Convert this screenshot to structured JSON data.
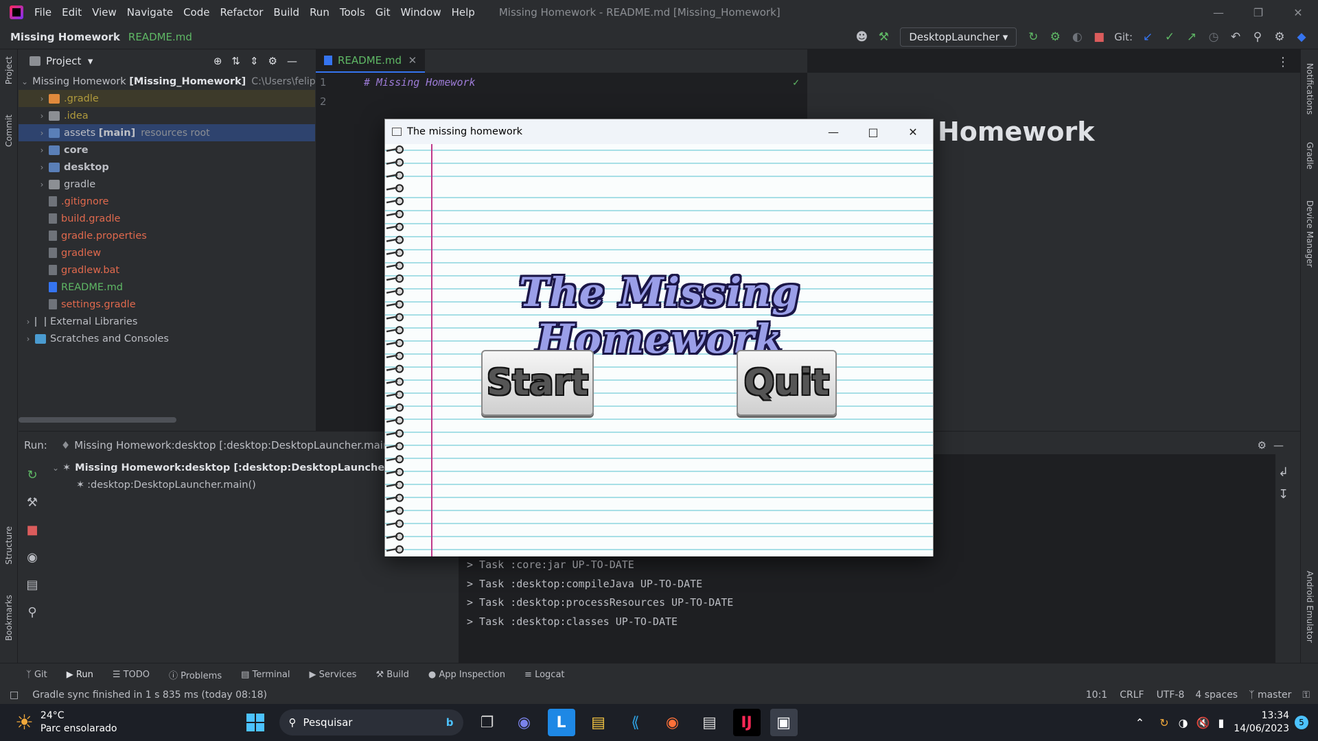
{
  "window_title": "Missing Homework - README.md [Missing_Homework]",
  "menu": [
    "File",
    "Edit",
    "View",
    "Navigate",
    "Code",
    "Refactor",
    "Build",
    "Run",
    "Tools",
    "Git",
    "Window",
    "Help"
  ],
  "nav": {
    "project": "Missing Homework",
    "file": "README.md",
    "run_config": "DesktopLauncher",
    "git_label": "Git:"
  },
  "project_panel": {
    "title": "Project",
    "items": [
      {
        "label": "Missing Homework",
        "bold": "[Missing_Homework]",
        "extra": "C:\\Users\\felip"
      },
      {
        "label": ".gradle"
      },
      {
        "label": ".idea"
      },
      {
        "label": "assets",
        "bold": "[main]",
        "extra": "resources root"
      },
      {
        "label": "core"
      },
      {
        "label": "desktop"
      },
      {
        "label": "gradle"
      },
      {
        "label": ".gitignore"
      },
      {
        "label": "build.gradle"
      },
      {
        "label": "gradle.properties"
      },
      {
        "label": "gradlew"
      },
      {
        "label": "gradlew.bat"
      },
      {
        "label": "README.md"
      },
      {
        "label": "settings.gradle"
      },
      {
        "label": "External Libraries"
      },
      {
        "label": "Scratches and Consoles"
      }
    ]
  },
  "editor": {
    "tab": "README.md",
    "lines": [
      "1",
      "2"
    ],
    "line1": "# Missing Homework",
    "preview_heading": "Homework"
  },
  "run_panel": {
    "label": "Run:",
    "tab": "Missing Homework:desktop [:desktop:DesktopLauncher.main()]",
    "tree_root": "Missing Homework:desktop [:desktop:DesktopLauncher.main()]",
    "tree_child": ":desktop:DesktopLauncher.main()",
    "console": [
      "> Task :core:jar UP-TO-DATE",
      "> Task :desktop:compileJava UP-TO-DATE",
      "> Task :desktop:processResources UP-TO-DATE",
      "> Task :desktop:classes UP-TO-DATE"
    ]
  },
  "bottom_tools": [
    "Git",
    "Run",
    "TODO",
    "Problems",
    "Terminal",
    "Services",
    "Build",
    "App Inspection",
    "Logcat"
  ],
  "status": {
    "message": "Gradle sync finished in 1 s 835 ms (today 08:18)",
    "pos": "10:1",
    "eol": "CRLF",
    "enc": "UTF-8",
    "indent": "4 spaces",
    "branch": "master"
  },
  "left_strip": [
    "Project",
    "Commit",
    "Structure",
    "Bookmarks"
  ],
  "right_strip": [
    "Notifications",
    "Gradle",
    "Device Manager",
    "Android Emulator"
  ],
  "game": {
    "window_title": "The missing homework",
    "heading": "The Missing Homework",
    "start": "Start",
    "quit": "Quit"
  },
  "taskbar": {
    "temp": "24°C",
    "weather": "Parc ensolarado",
    "search": "Pesquisar",
    "time": "13:34",
    "date": "14/06/2023",
    "badge": "5"
  }
}
